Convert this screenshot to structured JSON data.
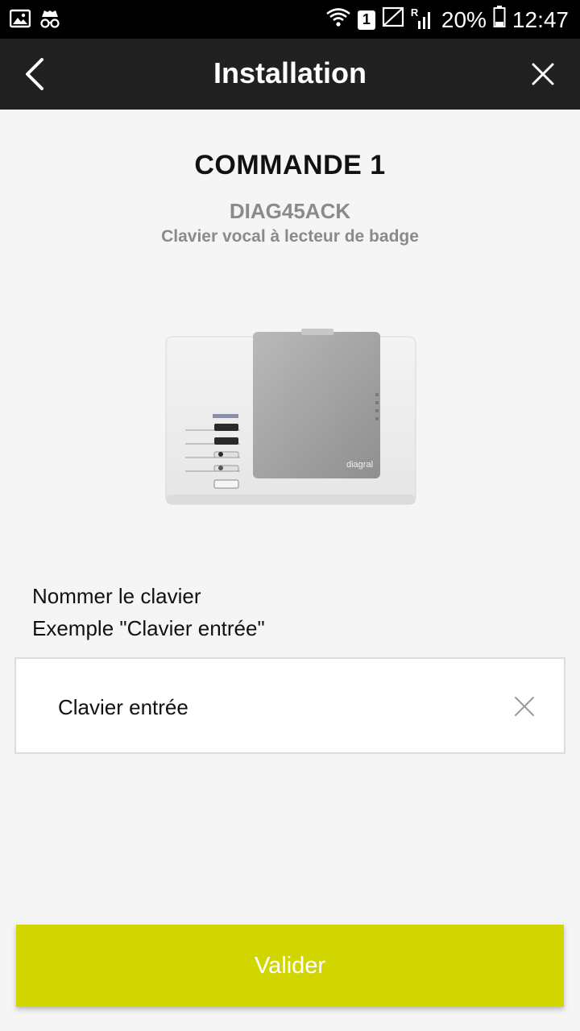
{
  "status_bar": {
    "sim_slot": "1",
    "roaming": "R",
    "battery": "20%",
    "time": "12:47"
  },
  "app_bar": {
    "title": "Installation"
  },
  "device": {
    "heading": "COMMANDE 1",
    "model": "DIAG45ACK",
    "description": "Clavier vocal à lecteur de badge",
    "brand_logo": "diagral"
  },
  "form": {
    "label": "Nommer le clavier",
    "example": "Exemple \"Clavier entrée\"",
    "name_value": "Clavier entrée"
  },
  "actions": {
    "validate_label": "Valider"
  },
  "colors": {
    "accent": "#d2d600",
    "app_bar": "#212121"
  }
}
